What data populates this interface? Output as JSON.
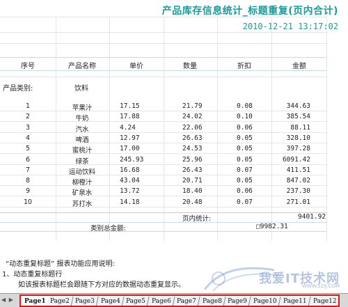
{
  "report": {
    "title": "产品库存信息统计_标题重复(页内合计)",
    "timestamp": "2010-12-21 13:17:02"
  },
  "columns": [
    "序号",
    "产品名称",
    "单价",
    "数量",
    "折扣",
    "金额"
  ],
  "category": {
    "label": "产品类别:",
    "value": "饮料"
  },
  "rows": [
    {
      "id": "1",
      "name": "苹果汁",
      "price": "17.15",
      "qty": "21.79",
      "discount": "0.08",
      "amount": "344.63"
    },
    {
      "id": "2",
      "name": "牛奶",
      "price": "17.88",
      "qty": "24.02",
      "discount": "0.10",
      "amount": "385.54"
    },
    {
      "id": "3",
      "name": "汽水",
      "price": "4.24",
      "qty": "22.06",
      "discount": "0.06",
      "amount": "88.11"
    },
    {
      "id": "4",
      "name": "啤酒",
      "price": "12.97",
      "qty": "26.63",
      "discount": "0.05",
      "amount": "328.10"
    },
    {
      "id": "5",
      "name": "蜜桃汁",
      "price": "17.00",
      "qty": "24.53",
      "discount": "0.05",
      "amount": "397.28"
    },
    {
      "id": "6",
      "name": "绿茶",
      "price": "245.93",
      "qty": "25.96",
      "discount": "0.05",
      "amount": "6091.42"
    },
    {
      "id": "7",
      "name": "运动饮料",
      "price": "16.68",
      "qty": "26.43",
      "discount": "0.07",
      "amount": "411.51"
    },
    {
      "id": "8",
      "name": "柳橙汁",
      "price": "43.04",
      "qty": "20.71",
      "discount": "0.05",
      "amount": "847.02"
    },
    {
      "id": "9",
      "name": "矿泉水",
      "price": "13.72",
      "qty": "18.40",
      "discount": "0.06",
      "amount": "237.30"
    },
    {
      "id": "10",
      "name": "苏打水",
      "price": "14.18",
      "qty": "20.48",
      "discount": "0.07",
      "amount": "271.01"
    }
  ],
  "page_total": {
    "label": "页内统计:",
    "value": "9401.92"
  },
  "category_total": {
    "label": "类别总金额:",
    "value": "□9982.31"
  },
  "notes": [
    "“动态重复标题” 报表功能应用说明:",
    "1、动态重复标题行",
    "如该报表标题栏会跟随下方对应的数据动态重复显示。"
  ],
  "tabs": [
    "Page1",
    "Page2",
    "Page3",
    "Page4",
    "Page5",
    "Page6",
    "Page7",
    "Page8",
    "Page9",
    "Page10",
    "Page11",
    "Page12"
  ],
  "active_tab": "Page1",
  "watermark": {
    "text": "我爱IT技术网",
    "sub": "WWW.52IJ.COM"
  },
  "colors": {
    "title": "#1a9a9a",
    "tab_highlight": "#d81a1a"
  }
}
